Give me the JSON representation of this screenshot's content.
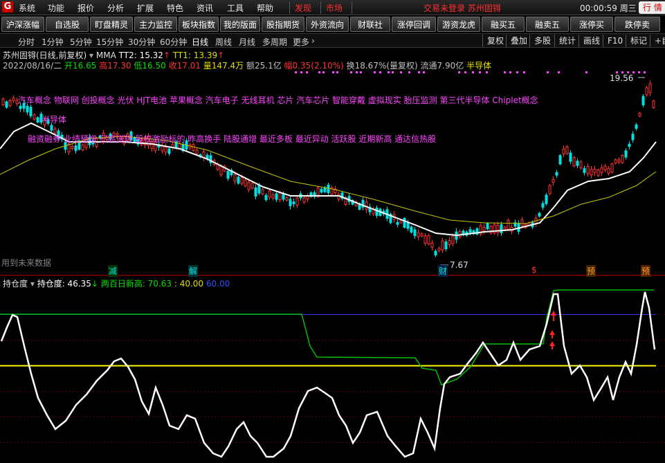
{
  "menubar": {
    "logo": "G",
    "items": [
      "系统",
      "功能",
      "报价",
      "分析",
      "扩展",
      "特色",
      "资讯",
      "工具",
      "帮助"
    ],
    "red_items": [
      "发现",
      "市场"
    ],
    "status": "交易未登录  苏州固锝",
    "clock": "00:00:59 周三",
    "right_label": "行  情"
  },
  "toolbar": {
    "buttons": [
      "沪深涨幅",
      "自选股",
      "盯盘精灵",
      "主力监控",
      "板块指数",
      "我的版面",
      "股指期货",
      "外资流向",
      "财联社",
      "涨停回调",
      "游资龙虎",
      "融买五",
      "融卖五",
      "涨停买",
      "跌停卖"
    ]
  },
  "periodbar": {
    "periods": [
      "分时",
      "1分钟",
      "5分钟",
      "15分钟",
      "30分钟",
      "60分钟",
      "日线",
      "周线",
      "月线",
      "多周期",
      "更多"
    ],
    "active": "日线",
    "right_buttons": [
      "复权",
      "叠加",
      "多股",
      "统计",
      "画线",
      "F10",
      "标记",
      "+自"
    ]
  },
  "stock": {
    "title": "苏州固锝(日线,前复权)",
    "indicator": "MMA",
    "tt2": "TT2: 15.32",
    "tt1": "TT1: 13.39",
    "date": "2022/08/16/二",
    "open": "开16.65",
    "high": "高17.30",
    "low": "低16.50",
    "close": "收17.01",
    "volume": "量147.4万",
    "amount": "额25.1亿",
    "change": "幅0.35(2.10%)",
    "turnover": "换18.67%(量复权)",
    "float": "流通7.90亿",
    "sector": "半导体"
  },
  "concepts": {
    "line1": "汽车概念 物联网 创投概念 光伏 HJT电池 苹果概念 汽车电子 无线耳机 芯片 汽车芯片 智能穿戴 虚拟现实 胎压监测 第三代半导体 Chiplet概念",
    "line2": "半导体",
    "line3": "融资融券 业绩预增 已高送转 股权激励标的 昨高换手 陆股通增 最近多板 最近异动 活跃股 近期新高 通达信热股"
  },
  "chart_labels": {
    "high_price": "19.56",
    "low_price": "7.67",
    "watermark": "用到未来数据",
    "markers": [
      "减",
      "解",
      "财",
      "$",
      "预",
      "预"
    ]
  },
  "indicator_panel": {
    "name": "持仓度",
    "line_label": "持仓度: 46.35",
    "sub_label": "两百日新高: 70.63",
    "level1": ": 40.00",
    "level2": "60.00"
  },
  "colors": {
    "up": "#ff3232",
    "down": "#00e0e0",
    "ma_white": "#ffffff",
    "ma_yellow": "#c8c800",
    "magenta": "#ff44ff",
    "green": "#00d000",
    "blue": "#3030ff",
    "yellow_line": "#ffff00"
  }
}
